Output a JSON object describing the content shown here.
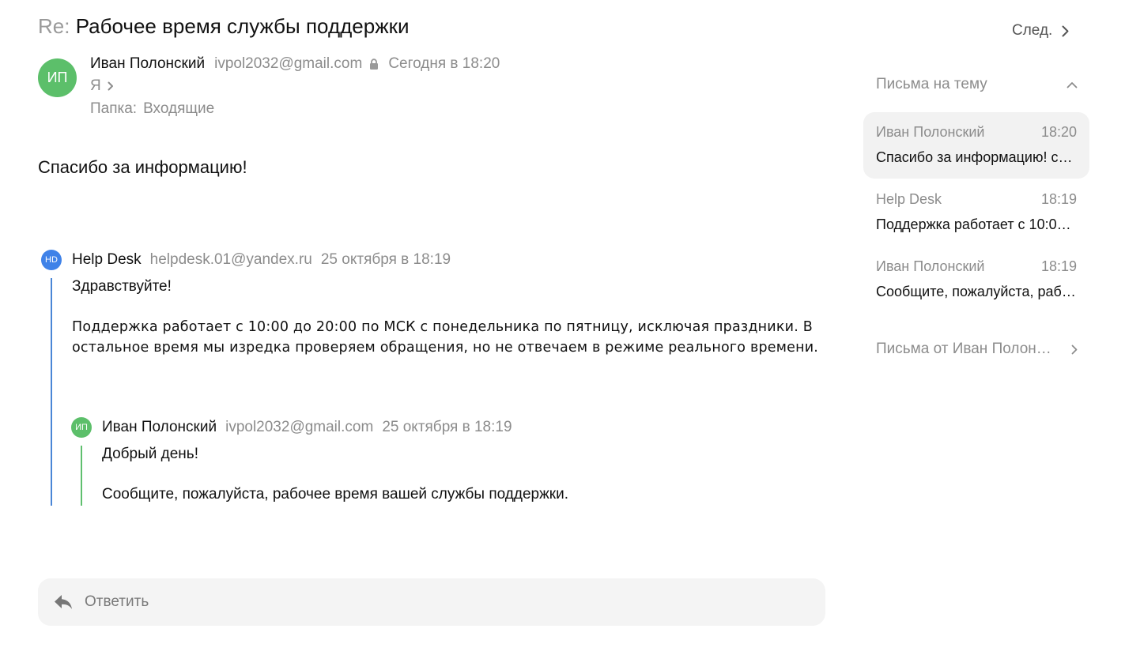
{
  "message": {
    "subject_prefix": "Re:",
    "subject": "Рабочее время службы поддержки",
    "sender": {
      "initials": "ИП",
      "name": "Иван Полонский",
      "email": "ivpol2032@gmail.com",
      "date": "Сегодня в 18:20",
      "avatar_color": "#5cbf6a"
    },
    "recipient": "Я",
    "folder_label": "Папка:",
    "folder_value": "Входящие",
    "body": "Спасибо за информацию!"
  },
  "quotes": [
    {
      "initials": "HD",
      "name": "Help Desk",
      "email": "helpdesk.01@yandex.ru",
      "date": "25 октября в 18:19",
      "avatar_color": "#3f82e8",
      "bar_color": "#4a86d6",
      "greeting": "Здравствуйте!",
      "body_line1": "Поддержка работает с 10:00 до 20:00 по МСК с понедельника по пятницу, исключая праздники. В",
      "body_line2": "остальное время мы изредка проверяем обращения, но не отвечаем в режиме реального времени."
    },
    {
      "initials": "ИП",
      "name": "Иван Полонский",
      "email": "ivpol2032@gmail.com",
      "date": "25 октября в 18:19",
      "avatar_color": "#5cbf6a",
      "bar_color": "#5fbf6e",
      "greeting": "Добрый день!",
      "body": "Сообщите, пожалуйста, рабочее время вашей службы поддержки."
    }
  ],
  "reply": {
    "label": "Ответить",
    "icon": "reply-arrow-icon"
  },
  "sidebar": {
    "next_label": "След.",
    "thread_header": "Письма на тему",
    "thread_items": [
      {
        "sender": "Иван Полонский",
        "time": "18:20",
        "snippet": "Спасибо за информацию! ср,...",
        "active": true
      },
      {
        "sender": "Help Desk",
        "time": "18:19",
        "snippet": "Поддержка работает с 10:00 ...",
        "active": false
      },
      {
        "sender": "Иван Полонский",
        "time": "18:19",
        "snippet": "Сообщите, пожалуйста, рабо...",
        "active": false
      }
    ],
    "letters_from": "Письма от Иван Полонс..."
  }
}
